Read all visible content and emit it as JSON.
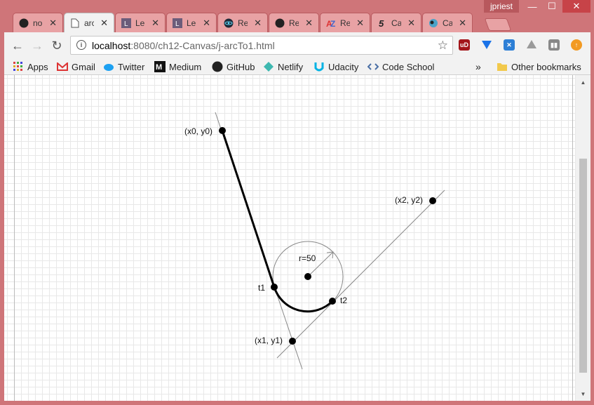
{
  "window": {
    "user": "jpriest",
    "minimize": "—",
    "maximize": "☐",
    "close": "✕"
  },
  "tabs": [
    {
      "label": "no",
      "icon": "github-icon",
      "active": false
    },
    {
      "label": "arc",
      "icon": "document-icon",
      "active": true
    },
    {
      "label": "Le",
      "icon": "letter-l-icon",
      "active": false
    },
    {
      "label": "Le",
      "icon": "letter-l-icon",
      "active": false
    },
    {
      "label": "Re",
      "icon": "react-icon",
      "active": false
    },
    {
      "label": "Re",
      "icon": "github-icon",
      "active": false
    },
    {
      "label": "Re",
      "icon": "az-icon",
      "active": false
    },
    {
      "label": "Ca",
      "icon": "five-icon",
      "active": false
    },
    {
      "label": "Ca",
      "icon": "bird-icon",
      "active": false
    }
  ],
  "toolbar": {
    "url_host": "localhost",
    "url_path": ":8080/ch12-Canvas/j-arcTo1.html"
  },
  "bookmarks": {
    "items": [
      "Apps",
      "Gmail",
      "Twitter",
      "Medium",
      "GitHub",
      "Netlify",
      "Udacity",
      "Code School"
    ],
    "overflow": "»",
    "other": "Other bookmarks"
  },
  "diagram": {
    "labels": {
      "p0": "(x0, y0)",
      "p2": "(x2, y2)",
      "p1": "(x1, y1)",
      "radius": "r=50",
      "t1": "t1",
      "t2": "t2"
    }
  }
}
